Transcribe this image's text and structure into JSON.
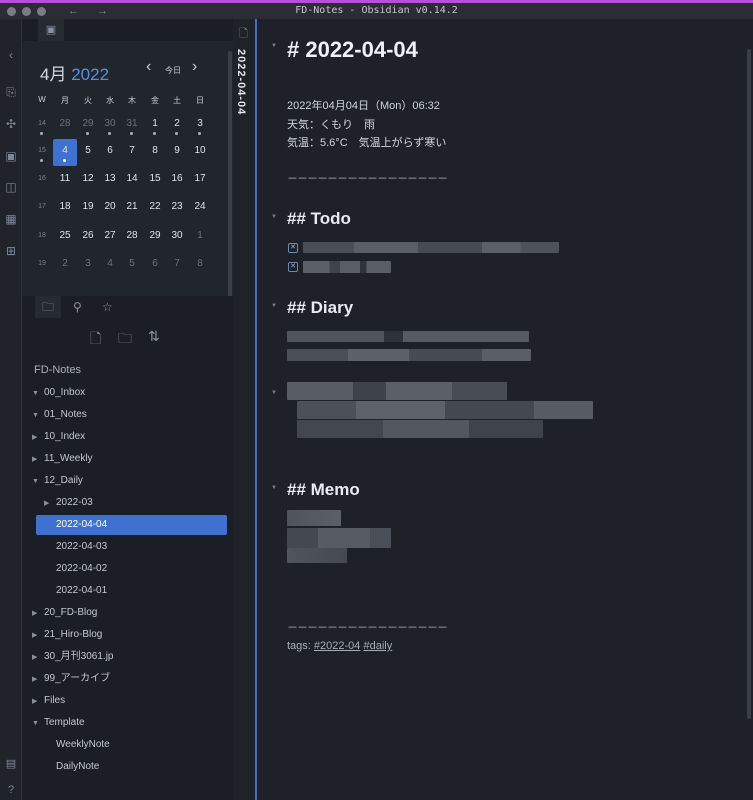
{
  "window": {
    "title": "FD-Notes - Obsidian v0.14.2",
    "nav_back": "←",
    "nav_forward": "→"
  },
  "calendar": {
    "month": "4月",
    "year": "2022",
    "today_label": "今日",
    "prev": "‹",
    "next": "›",
    "weekday_labels": [
      "W",
      "月",
      "火",
      "水",
      "木",
      "金",
      "土",
      "日"
    ],
    "weeks": [
      {
        "wk": "14",
        "days": [
          "28",
          "29",
          "30",
          "31",
          "1",
          "2",
          "3"
        ],
        "dim": [
          true,
          true,
          true,
          true,
          false,
          false,
          false
        ],
        "dots": [
          false,
          true,
          true,
          true,
          true,
          true,
          true
        ]
      },
      {
        "wk": "15",
        "days": [
          "4",
          "5",
          "6",
          "7",
          "8",
          "9",
          "10"
        ],
        "dim": [
          false,
          false,
          false,
          false,
          false,
          false,
          false
        ],
        "dots": [
          false,
          false,
          false,
          false,
          false,
          false,
          false
        ]
      },
      {
        "wk": "16",
        "days": [
          "11",
          "12",
          "13",
          "14",
          "15",
          "16",
          "17"
        ],
        "dim": [
          false,
          false,
          false,
          false,
          false,
          false,
          false
        ],
        "dots": [
          false,
          false,
          false,
          false,
          false,
          false,
          false
        ]
      },
      {
        "wk": "17",
        "days": [
          "18",
          "19",
          "20",
          "21",
          "22",
          "23",
          "24"
        ],
        "dim": [
          false,
          false,
          false,
          false,
          false,
          false,
          false
        ],
        "dots": [
          false,
          false,
          false,
          false,
          false,
          false,
          false
        ]
      },
      {
        "wk": "18",
        "days": [
          "25",
          "26",
          "27",
          "28",
          "29",
          "30",
          "1"
        ],
        "dim": [
          false,
          false,
          false,
          false,
          false,
          false,
          true
        ],
        "dots": [
          false,
          false,
          false,
          false,
          false,
          false,
          false
        ]
      },
      {
        "wk": "19",
        "days": [
          "2",
          "3",
          "4",
          "5",
          "6",
          "7",
          "8"
        ],
        "dim": [
          true,
          true,
          true,
          true,
          true,
          true,
          true
        ],
        "dots": [
          false,
          false,
          false,
          false,
          false,
          false,
          false
        ]
      }
    ],
    "selected_day": "4",
    "accent_color": "#3f72d0"
  },
  "explorer": {
    "vault_name": "FD-Notes",
    "items": [
      {
        "label": "00_Inbox",
        "arrow": "▼",
        "level": 0
      },
      {
        "label": "01_Notes",
        "arrow": "▼",
        "level": 0
      },
      {
        "label": "10_Index",
        "arrow": "▶",
        "level": 0
      },
      {
        "label": "11_Weekly",
        "arrow": "▶",
        "level": 0
      },
      {
        "label": "12_Daily",
        "arrow": "▼",
        "level": 0
      },
      {
        "label": "2022-03",
        "arrow": "▶",
        "level": 1
      },
      {
        "label": "2022-04-04",
        "arrow": "",
        "level": 1,
        "selected": true
      },
      {
        "label": "2022-04-03",
        "arrow": "",
        "level": 1
      },
      {
        "label": "2022-04-02",
        "arrow": "",
        "level": 1
      },
      {
        "label": "2022-04-01",
        "arrow": "",
        "level": 1
      },
      {
        "label": "20_FD-Blog",
        "arrow": "▶",
        "level": 0
      },
      {
        "label": "21_Hiro-Blog",
        "arrow": "▶",
        "level": 0
      },
      {
        "label": "30_月刊3061.jp",
        "arrow": "▶",
        "level": 0
      },
      {
        "label": "99_アーカイブ",
        "arrow": "▶",
        "level": 0
      },
      {
        "label": "Files",
        "arrow": "▶",
        "level": 0
      },
      {
        "label": "Template",
        "arrow": "▼",
        "level": 0
      },
      {
        "label": "WeeklyNote",
        "arrow": "",
        "level": 1
      },
      {
        "label": "DailyNote",
        "arrow": "",
        "level": 1
      }
    ]
  },
  "editor": {
    "tab_title": "2022-04-04",
    "heading": "# 2022-04-04",
    "meta_lines": [
      "2022年04月04日（Mon）06:32",
      "天気：くもり　雨",
      "気温：5.6°C　気温上がらず寒い"
    ],
    "hr": "－－－－－－－－－－－－－－－－",
    "todo_heading": "## Todo",
    "todo_check": "✕",
    "diary_heading": "## Diary",
    "memo_heading": "## Memo",
    "tags_label": "tags: ",
    "tags": [
      "#2022-04",
      "#daily"
    ]
  }
}
